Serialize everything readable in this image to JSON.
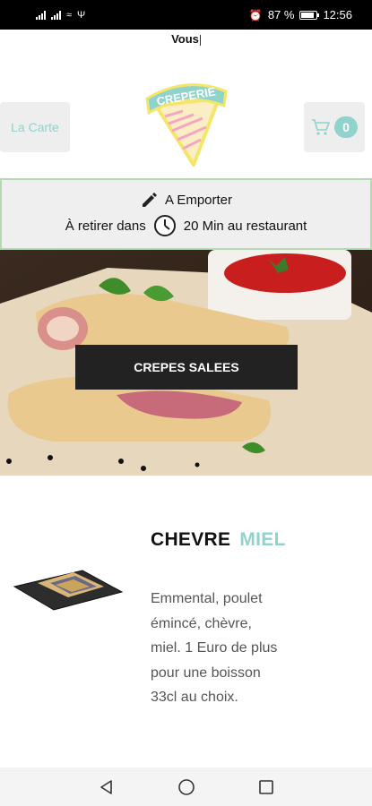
{
  "status_bar": {
    "battery": "87 %",
    "time": "12:56",
    "battery_level": 0.87
  },
  "top_label": "Vous",
  "header": {
    "menu_button_label": "La Carte",
    "logo_text": "CREPERIE",
    "cart_count": "0"
  },
  "order_mode": {
    "mode": "A Emporter",
    "pickup_prefix": "À retirer dans",
    "pickup_time": "20 Min au restaurant"
  },
  "hero": {
    "category_button": "CREPES SALEES"
  },
  "product": {
    "name_part1": "CHEVRE",
    "name_part2": "MIEL",
    "description": "Emmental, poulet émincé, chèvre, miel. 1 Euro de plus pour une boisson 33cl au choix."
  },
  "colors": {
    "accent": "#8fd3cc",
    "panel_border": "#b5d9b0",
    "hero_button": "#222222"
  }
}
